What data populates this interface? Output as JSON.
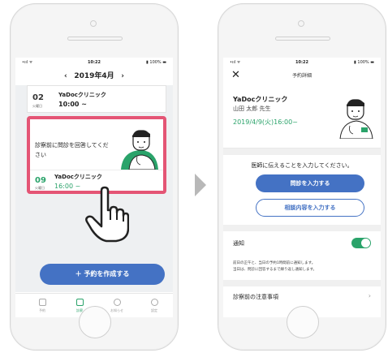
{
  "left_phone": {
    "status": {
      "signal": "•ııl ᯤ",
      "time": "10:22",
      "battery": "▮ 100% ▬"
    },
    "month_bar": {
      "prev": "‹",
      "label": "2019年4月",
      "next": "›"
    },
    "appointments": [
      {
        "day": "02",
        "weekday": "火曜日",
        "clinic": "YaDocクリニック",
        "time": "10:00 ~"
      }
    ],
    "highlight": {
      "message": "診察前に問診を回答してください",
      "day": "09",
      "weekday": "火曜日",
      "clinic": "YaDocクリニック",
      "time": "16:00 ~"
    },
    "create_button": "＋ 予約を作成する",
    "tabs": [
      {
        "label": "予約"
      },
      {
        "label": "診察"
      },
      {
        "label": "お知らせ"
      },
      {
        "label": "設定"
      }
    ]
  },
  "right_phone": {
    "status": {
      "signal": "•ııl ᯤ",
      "time": "10:22",
      "battery": "▮ 100% ▬"
    },
    "nav": {
      "close": "✕",
      "title": "予約詳細"
    },
    "clinic": "YaDocクリニック",
    "doctor": "山田 太郎 先生",
    "datetime": "2019/4/9(火)16:00~",
    "prompt": "医師に伝えることを入力してください。",
    "primary_button": "問診を入力する",
    "secondary_button": "相談内容を入力する",
    "notify_label": "通知",
    "notify_on": true,
    "note1": "前日の正午と、当日の予約1時間前に通知します。",
    "note2": "当日は、問診に回答するまで繰り返し通知します。",
    "notice_label": "診察前の注意事項",
    "notice_chevron": "›"
  },
  "colors": {
    "accent_blue": "#4472c4",
    "accent_green": "#2aa36a",
    "highlight_pink": "#e45575"
  }
}
